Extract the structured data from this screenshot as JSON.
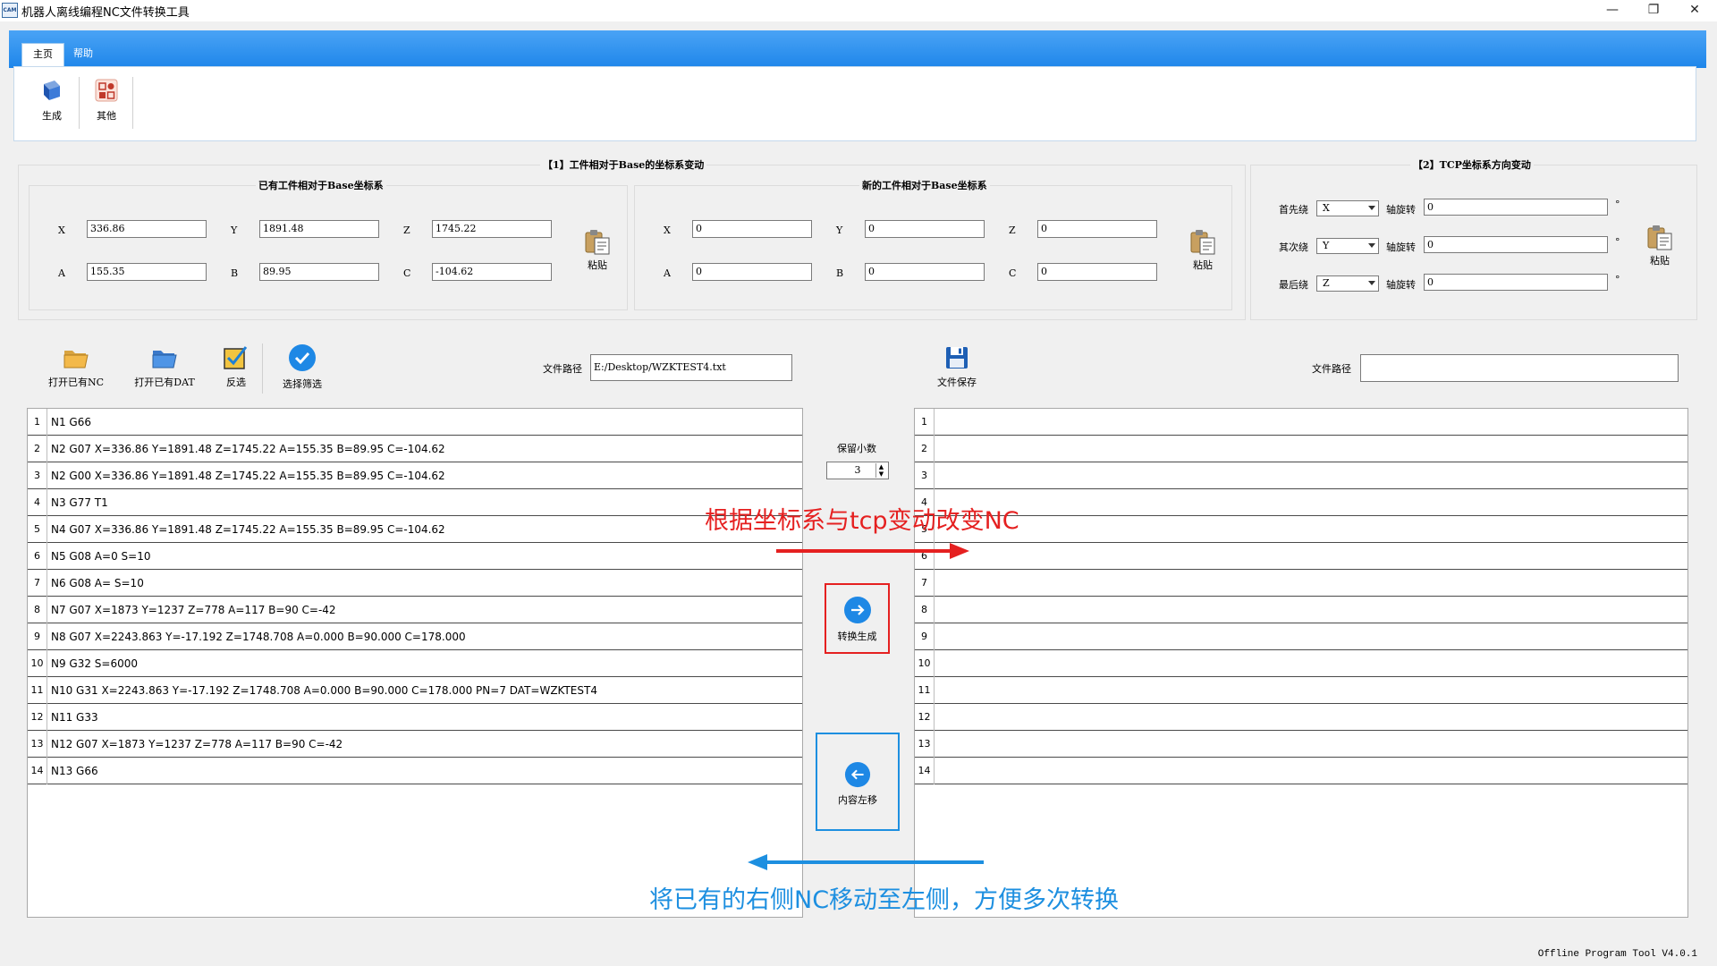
{
  "window": {
    "title": "机器人离线编程NC文件转换工具",
    "icon_text": "CAM",
    "controls": {
      "minimize": "—",
      "restore": "❐",
      "close": "✕"
    }
  },
  "ribbon": {
    "tabs": [
      {
        "label": "主页",
        "active": true
      },
      {
        "label": "帮助",
        "active": false
      }
    ],
    "buttons": [
      {
        "label": "生成",
        "icon": "generate-icon"
      },
      {
        "label": "其他",
        "icon": "other-icon"
      }
    ]
  },
  "base_transform": {
    "title": "【1】工件相对于Base的坐标系变动",
    "existing": {
      "title": "已有工件相对于Base坐标系",
      "fields": [
        {
          "label": "X",
          "value": "336.86"
        },
        {
          "label": "Y",
          "value": "1891.48"
        },
        {
          "label": "Z",
          "value": "1745.22"
        },
        {
          "label": "A",
          "value": "155.35"
        },
        {
          "label": "B",
          "value": "89.95"
        },
        {
          "label": "C",
          "value": "-104.62"
        }
      ],
      "paste_label": "粘贴"
    },
    "new": {
      "title": "新的工件相对于Base坐标系",
      "fields": [
        {
          "label": "X",
          "value": "0"
        },
        {
          "label": "Y",
          "value": "0"
        },
        {
          "label": "Z",
          "value": "0"
        },
        {
          "label": "A",
          "value": "0"
        },
        {
          "label": "B",
          "value": "0"
        },
        {
          "label": "C",
          "value": "0"
        }
      ],
      "paste_label": "粘贴"
    }
  },
  "tcp_transform": {
    "title": "【2】TCP坐标系方向变动",
    "rows": [
      {
        "label": "首先绕",
        "axis": "X",
        "rot_label": "轴旋转",
        "value": "0",
        "unit": "°"
      },
      {
        "label": "其次绕",
        "axis": "Y",
        "rot_label": "轴旋转",
        "value": "0",
        "unit": "°"
      },
      {
        "label": "最后绕",
        "axis": "Z",
        "rot_label": "轴旋转",
        "value": "0",
        "unit": "°"
      }
    ],
    "paste_label": "粘贴"
  },
  "left_toolbar": {
    "buttons": [
      {
        "label": "打开已有NC",
        "icon": "folder-open-icon"
      },
      {
        "label": "打开已有DAT",
        "icon": "folder-open-blue-icon"
      },
      {
        "label": "反选",
        "icon": "checkbox-icon"
      },
      {
        "label": "选择筛选",
        "icon": "check-circle-icon"
      }
    ],
    "path_label": "文件路径",
    "path_value": "E:/Desktop/WZKTEST4.txt"
  },
  "right_toolbar": {
    "save_label": "文件保存",
    "path_label": "文件路径",
    "path_value": ""
  },
  "left_editor": {
    "lines": [
      {
        "n": "1",
        "text": "N1 G66"
      },
      {
        "n": "2",
        "text": "N2 G07 X=336.86 Y=1891.48 Z=1745.22 A=155.35 B=89.95 C=-104.62"
      },
      {
        "n": "3",
        "text": "N2 G00 X=336.86 Y=1891.48 Z=1745.22 A=155.35 B=89.95 C=-104.62"
      },
      {
        "n": "4",
        "text": "N3 G77 T1"
      },
      {
        "n": "5",
        "text": "N4 G07 X=336.86 Y=1891.48 Z=1745.22 A=155.35 B=89.95 C=-104.62"
      },
      {
        "n": "6",
        "text": "N5 G08 A=0 S=10"
      },
      {
        "n": "7",
        "text": "N6 G08 A= S=10"
      },
      {
        "n": "8",
        "text": "N7 G07 X=1873 Y=1237 Z=778 A=117 B=90 C=-42"
      },
      {
        "n": "9",
        "text": "N8 G07 X=2243.863 Y=-17.192 Z=1748.708 A=0.000 B=90.000 C=178.000"
      },
      {
        "n": "10",
        "text": "N9 G32 S=6000"
      },
      {
        "n": "11",
        "text": "N10 G31 X=2243.863 Y=-17.192 Z=1748.708 A=0.000 B=90.000 C=178.000 PN=7 DAT=WZKTEST4"
      },
      {
        "n": "12",
        "text": "N11 G33"
      },
      {
        "n": "13",
        "text": "N12 G07 X=1873 Y=1237 Z=778 A=117 B=90 C=-42"
      },
      {
        "n": "14",
        "text": "N13 G66"
      }
    ]
  },
  "right_editor": {
    "lines": [
      {
        "n": "1",
        "text": ""
      },
      {
        "n": "2",
        "text": ""
      },
      {
        "n": "3",
        "text": ""
      },
      {
        "n": "4",
        "text": ""
      },
      {
        "n": "5",
        "text": ""
      },
      {
        "n": "6",
        "text": ""
      },
      {
        "n": "7",
        "text": ""
      },
      {
        "n": "8",
        "text": ""
      },
      {
        "n": "9",
        "text": ""
      },
      {
        "n": "10",
        "text": ""
      },
      {
        "n": "11",
        "text": ""
      },
      {
        "n": "12",
        "text": ""
      },
      {
        "n": "13",
        "text": ""
      },
      {
        "n": "14",
        "text": ""
      }
    ]
  },
  "center": {
    "decimals_label": "保留小数",
    "decimals_value": "3",
    "convert_label": "转换生成",
    "move_left_label": "内容左移"
  },
  "annotations": {
    "red": "根据坐标系与tcp变动改变NC",
    "blue": "将已有的右侧NC移动至左侧，方便多次转换",
    "red_color": "#e52020",
    "blue_color": "#1d8fe0"
  },
  "status": {
    "version": "Offline Program Tool V4.0.1"
  }
}
